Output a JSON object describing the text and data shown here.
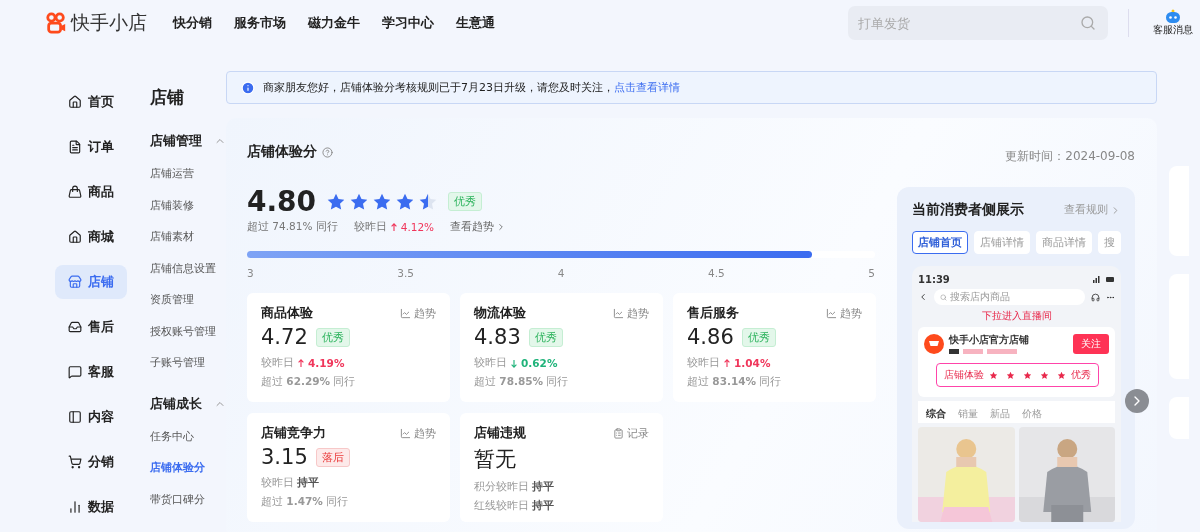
{
  "top_bar": {
    "logo": "快手小店",
    "nav": [
      "快分销",
      "服务市场",
      "磁力金牛",
      "学习中心",
      "生意通"
    ],
    "search": {
      "placeholder": "打单发货"
    },
    "message": {
      "label": "客服消息"
    }
  },
  "sidebar": {
    "items": [
      {
        "label": "首页",
        "selected": false
      },
      {
        "label": "订单",
        "selected": false
      },
      {
        "label": "商品",
        "selected": false
      },
      {
        "label": "商城",
        "selected": false
      },
      {
        "label": "店铺",
        "selected": true
      },
      {
        "label": "售后",
        "selected": false
      },
      {
        "label": "客服",
        "selected": false
      },
      {
        "label": "内容",
        "selected": false
      },
      {
        "label": "分销",
        "selected": false
      },
      {
        "label": "数据",
        "selected": false
      }
    ]
  },
  "submenu": {
    "title": "店铺",
    "groups": [
      {
        "title": "店铺管理",
        "expanded": true,
        "items": [
          {
            "label": "店铺运营",
            "selected": false
          },
          {
            "label": "店铺装修",
            "selected": false
          },
          {
            "label": "店铺素材",
            "selected": false
          },
          {
            "label": "店铺信息设置",
            "selected": false
          },
          {
            "label": "资质管理",
            "selected": false
          },
          {
            "label": "授权账号管理",
            "selected": false
          },
          {
            "label": "子账号管理",
            "selected": false
          }
        ]
      },
      {
        "title": "店铺成长",
        "expanded": true,
        "items": [
          {
            "label": "任务中心",
            "selected": false
          },
          {
            "label": "店铺体验分",
            "selected": true
          },
          {
            "label": "带货口碑分",
            "selected": false
          }
        ]
      }
    ]
  },
  "notice": {
    "text": "商家朋友您好，店铺体验分考核规则已于7月23日升级，请您及时关注，",
    "link": "点击查看详情"
  },
  "score": {
    "title": "店铺体验分",
    "updated": "更新时间：2024-09-08",
    "value": "4.80",
    "stars": 4.5,
    "badge": {
      "label": "优秀",
      "kind": "good"
    },
    "beat": "超过 74.81% 同行",
    "change_label": "较昨日",
    "change": {
      "text": "4.12%",
      "kind": "rise"
    },
    "trend_link": "查看趋势",
    "level": 0.9,
    "ticks": [
      "3",
      "3.5",
      "4",
      "4.5",
      "5"
    ]
  },
  "metrics": [
    {
      "title": "商品体验",
      "action": {
        "kind": "trend",
        "label": "趋势"
      },
      "value": "4.72",
      "badge": {
        "label": "优秀",
        "kind": "good"
      },
      "lines": [
        {
          "kind": "rise",
          "label": "较昨日",
          "value": "4.19%"
        },
        {
          "kind": "text",
          "text": "超过 **62.29%** 同行"
        }
      ]
    },
    {
      "title": "物流体验",
      "action": {
        "kind": "trend",
        "label": "趋势"
      },
      "value": "4.83",
      "badge": {
        "label": "优秀",
        "kind": "good"
      },
      "lines": [
        {
          "kind": "fall",
          "label": "较昨日",
          "value": "0.62%"
        },
        {
          "kind": "text",
          "text": "超过 **78.85%** 同行"
        }
      ]
    },
    {
      "title": "售后服务",
      "action": {
        "kind": "trend",
        "label": "趋势"
      },
      "value": "4.86",
      "badge": {
        "label": "优秀",
        "kind": "good"
      },
      "lines": [
        {
          "kind": "rise",
          "label": "较昨日",
          "value": "1.04%"
        },
        {
          "kind": "text",
          "text": "超过 **83.14%** 同行"
        }
      ]
    },
    {
      "title": "店铺竞争力",
      "action": {
        "kind": "trend",
        "label": "趋势"
      },
      "value": "3.15",
      "badge": {
        "label": "落后",
        "kind": "bad"
      },
      "lines": [
        {
          "kind": "flat",
          "label": "较昨日",
          "value": "持平"
        },
        {
          "kind": "text",
          "text": "超过 **1.47%** 同行"
        }
      ]
    },
    {
      "title": "店铺违规",
      "action": {
        "kind": "record",
        "label": "记录"
      },
      "value": "暂无",
      "lines": [
        {
          "kind": "flat",
          "label": "积分较昨日",
          "value": "持平"
        },
        {
          "kind": "flat",
          "label": "红线较昨日",
          "value": "持平"
        }
      ]
    }
  ],
  "consumer_view": {
    "title": "当前消费者侧展示",
    "rules_link": "查看规则",
    "tabs": [
      {
        "label": "店铺首页",
        "selected": true
      },
      {
        "label": "店铺详情",
        "selected": false
      },
      {
        "label": "商品详情",
        "selected": false
      },
      {
        "label": "搜",
        "selected": false
      }
    ],
    "preview": {
      "time": "11:39",
      "search": "搜索店内商品",
      "pull_hint": "下拉进入直播间",
      "shop_name": "快手小店官方店铺",
      "follow": "关注",
      "popup": {
        "label": "店铺体验",
        "stars": 5,
        "badge": "优秀"
      },
      "sort_tabs": [
        "综合",
        "销量",
        "新品",
        "价格"
      ]
    }
  }
}
